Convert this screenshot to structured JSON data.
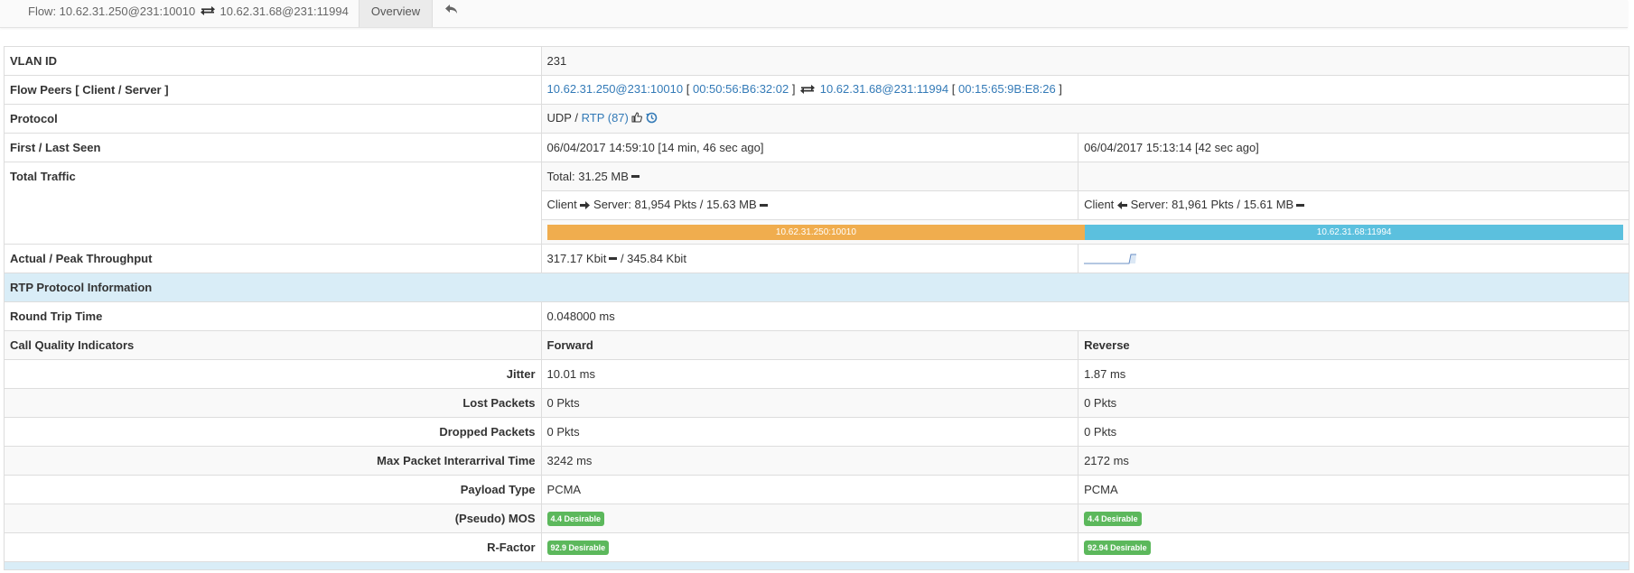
{
  "nav": {
    "flow_prefix": "Flow: 10.62.31.250@231:10010",
    "flow_suffix": "10.62.31.68@231:11994",
    "overview_tab": "Overview",
    "back_icon": "reply-icon"
  },
  "rows": {
    "vlan": {
      "label": "VLAN ID",
      "value": "231"
    },
    "peers": {
      "label": "Flow Peers [ Client / Server ]",
      "client": "10.62.31.250@231:10010",
      "client_mac": "00:50:56:B6:32:02",
      "server": "10.62.31.68@231:11994",
      "server_mac": "00:15:65:9B:E8:26",
      "open_bracket": "[",
      "close_bracket": "]"
    },
    "protocol": {
      "label": "Protocol",
      "l4": "UDP /",
      "l7": "RTP (87)"
    },
    "seen": {
      "label": "First / Last Seen",
      "first": "06/04/2017 14:59:10 [14 min, 46 sec ago]",
      "last": "06/04/2017 15:13:14 [42 sec ago]"
    },
    "traffic": {
      "label": "Total Traffic",
      "total": "Total: 31.25 MB",
      "c2s_a": "Client",
      "c2s_b": "Server: 81,954 Pkts / 15.63 MB",
      "s2c_a": "Client",
      "s2c_b": "Server: 81,961 Pkts / 15.61 MB",
      "bar_client_label": "10.62.31.250:10010",
      "bar_server_label": "10.62.31.68:11994",
      "bar_client_share": 0.5
    },
    "throughput": {
      "label": "Actual / Peak Throughput",
      "actual": "317.17 Kbit",
      "peak": "/ 345.84 Kbit"
    },
    "rtp_header": "RTP Protocol Information",
    "rtt": {
      "label": "Round Trip Time",
      "value": "0.048000 ms"
    },
    "cqi": {
      "label": "Call Quality Indicators",
      "forward": "Forward",
      "reverse": "Reverse"
    },
    "jitter": {
      "label": "Jitter",
      "fwd": "10.01 ms",
      "rev": "1.87 ms"
    },
    "lost": {
      "label": "Lost Packets",
      "fwd": "0 Pkts",
      "rev": "0 Pkts"
    },
    "dropped": {
      "label": "Dropped Packets",
      "fwd": "0 Pkts",
      "rev": "0 Pkts"
    },
    "interarrival": {
      "label": "Max Packet Interarrival Time",
      "fwd": "3242 ms",
      "rev": "2172 ms"
    },
    "payload": {
      "label": "Payload Type",
      "fwd": "PCMA",
      "rev": "PCMA"
    },
    "mos": {
      "label": "(Pseudo) MOS",
      "fwd": "4.4 Desirable",
      "rev": "4.4 Desirable"
    },
    "rfactor": {
      "label": "R-Factor",
      "fwd": "92.9 Desirable",
      "rev": "92.94 Desirable"
    }
  },
  "colors": {
    "link": "#337ab7",
    "badge_green": "#5cb85c",
    "client_bar": "#f0ad4e",
    "server_bar": "#5bc0de",
    "section_header": "#d9edf7"
  }
}
